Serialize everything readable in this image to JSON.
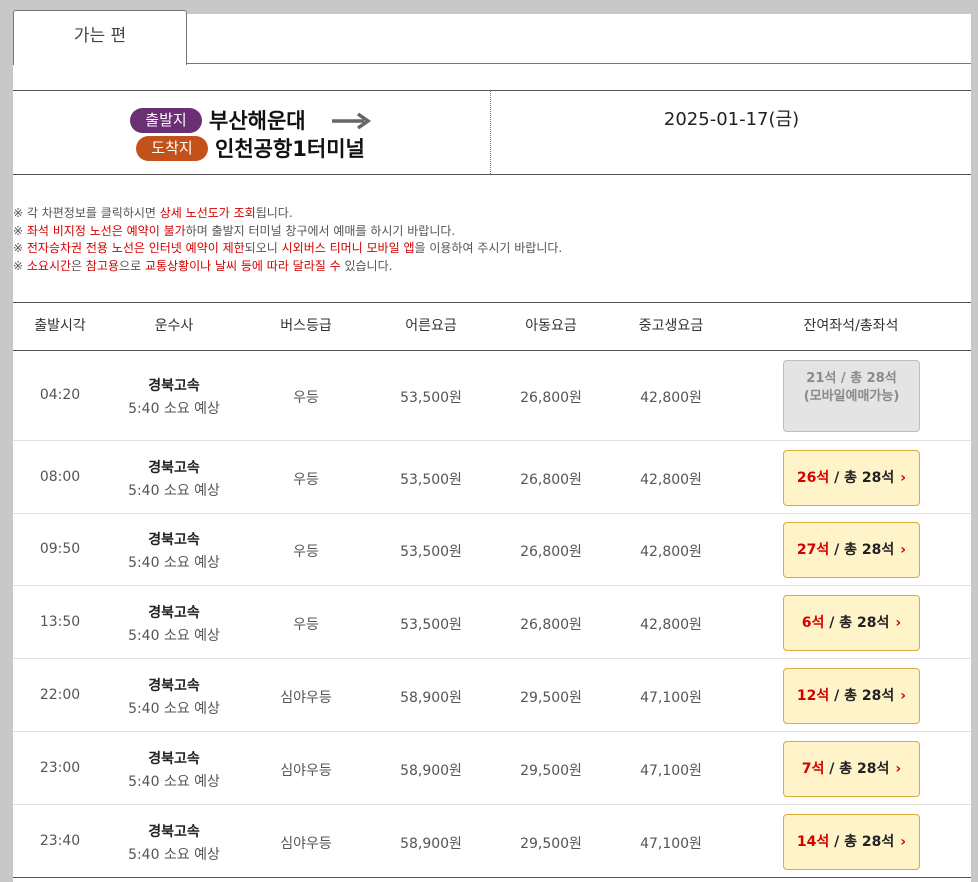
{
  "tab": {
    "label": "가는 편"
  },
  "route": {
    "departure_badge": "출발지",
    "departure": "부산해운대",
    "arrival_badge": "도착지",
    "arrival": "인천공항1터미널",
    "date": "2025-01-17(금)",
    "departure_badge_color": "#6b2f73",
    "arrival_badge_color": "#c3521a"
  },
  "notes": [
    [
      "※ 각 차편정보를 클릭하시면 ",
      {
        "red": "상세 노선도가 조회"
      },
      "됩니다."
    ],
    [
      "※ ",
      {
        "red": "좌석 비지정 노선은 예약이 불가"
      },
      "하며 출발지 터미널 창구에서 예매를 하시기 바랍니다."
    ],
    [
      "※ ",
      {
        "red": "전자승차권 전용 노선은 인터넷 예약이 제한"
      },
      "되오니 ",
      {
        "red": "시외버스 티머니 모바일 앱"
      },
      "을 이용하여 주시기 바랍니다."
    ],
    [
      "※ ",
      {
        "red": "소요시간"
      },
      "은 ",
      {
        "red": "참고용"
      },
      "으로 ",
      {
        "red": "교통상황이나 날씨 등에 따라 달라질 수"
      },
      " 있습니다."
    ]
  ],
  "table": {
    "headers": [
      "출발시각",
      "운수사",
      "버스등급",
      "어른요금",
      "아동요금",
      "중고생요금",
      "잔여좌석/총좌석"
    ],
    "rows": [
      {
        "time": "04:20",
        "company": "경북고속",
        "duration": "5:40 소요 예상",
        "grade": "우등",
        "adult": "53,500원",
        "child": "26,800원",
        "youth": "42,800원",
        "remaining": "21석",
        "total": "/ 총 28석",
        "note": "(모바일예매가능)",
        "disabled": true
      },
      {
        "time": "08:00",
        "company": "경북고속",
        "duration": "5:40 소요 예상",
        "grade": "우등",
        "adult": "53,500원",
        "child": "26,800원",
        "youth": "42,800원",
        "remaining": "26석",
        "total": "/ 총 28석",
        "note": "",
        "disabled": false
      },
      {
        "time": "09:50",
        "company": "경북고속",
        "duration": "5:40 소요 예상",
        "grade": "우등",
        "adult": "53,500원",
        "child": "26,800원",
        "youth": "42,800원",
        "remaining": "27석",
        "total": "/ 총 28석",
        "note": "",
        "disabled": false
      },
      {
        "time": "13:50",
        "company": "경북고속",
        "duration": "5:40 소요 예상",
        "grade": "우등",
        "adult": "53,500원",
        "child": "26,800원",
        "youth": "42,800원",
        "remaining": "6석",
        "total": "/ 총 28석",
        "note": "",
        "disabled": false
      },
      {
        "time": "22:00",
        "company": "경북고속",
        "duration": "5:40 소요 예상",
        "grade": "심야우등",
        "adult": "58,900원",
        "child": "29,500원",
        "youth": "47,100원",
        "remaining": "12석",
        "total": "/ 총 28석",
        "note": "",
        "disabled": false
      },
      {
        "time": "23:00",
        "company": "경북고속",
        "duration": "5:40 소요 예상",
        "grade": "심야우등",
        "adult": "58,900원",
        "child": "29,500원",
        "youth": "47,100원",
        "remaining": "7석",
        "total": "/ 총 28석",
        "note": "",
        "disabled": false
      },
      {
        "time": "23:40",
        "company": "경북고속",
        "duration": "5:40 소요 예상",
        "grade": "심야우등",
        "adult": "58,900원",
        "child": "29,500원",
        "youth": "47,100원",
        "remaining": "14석",
        "total": "/ 총 28석",
        "note": "",
        "disabled": false
      }
    ]
  },
  "icons": {
    "route_arrow": "arrow-right-icon",
    "seat_chevron": "chevron-right-icon"
  }
}
